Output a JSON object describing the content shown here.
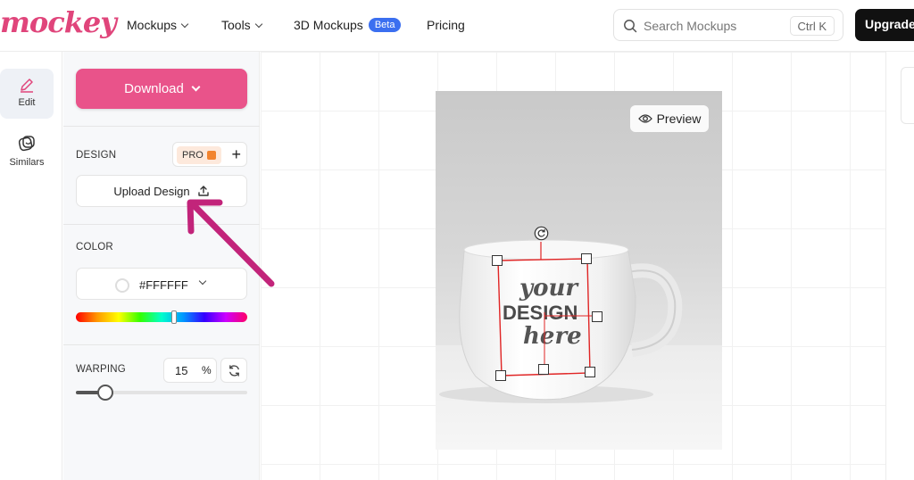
{
  "header": {
    "logo": "mockey",
    "nav": [
      {
        "label": "Mockups"
      },
      {
        "label": "Tools"
      },
      {
        "label": "3D Mockups",
        "badge": "Beta"
      },
      {
        "label": "Pricing"
      }
    ],
    "search": {
      "placeholder": "Search Mockups",
      "shortcut": "Ctrl K"
    },
    "upgrade_label": "Upgrade"
  },
  "rail": {
    "items": [
      {
        "label": "Edit",
        "icon": "pencil-icon",
        "active": true
      },
      {
        "label": "Similars",
        "icon": "similars-icon",
        "active": false
      }
    ]
  },
  "panel": {
    "download_label": "Download",
    "design": {
      "label": "DESIGN",
      "pro_label": "PRO",
      "upload_label": "Upload Design"
    },
    "color": {
      "label": "COLOR",
      "value": "#FFFFFF"
    },
    "warping": {
      "label": "WARPING",
      "value": "15",
      "unit": "%",
      "level": 15
    }
  },
  "canvas": {
    "preview_label": "Preview",
    "design_placeholder": {
      "line1": "your",
      "line2": "DESIGN",
      "line3": "here"
    }
  },
  "colors": {
    "accent": "#e9538a",
    "logo": "#e0457b",
    "annotation_arrow": "#c2247a",
    "selection": "#e02424",
    "beta": "#3b6ff0"
  }
}
